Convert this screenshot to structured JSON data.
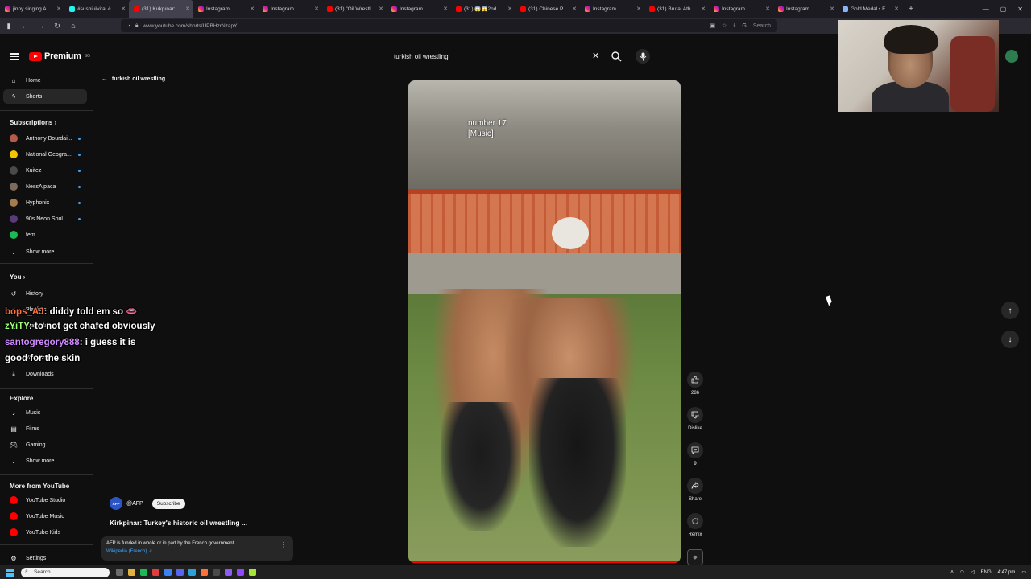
{
  "browser": {
    "tabs": [
      {
        "label": "jinny singing AWAY",
        "favicon": "ig"
      },
      {
        "label": "#sushi #viral #chall",
        "favicon": "tt"
      },
      {
        "label": "(31) Kırkpınar:",
        "favicon": "yt",
        "active": true
      },
      {
        "label": "Instagram",
        "favicon": "ig"
      },
      {
        "label": "Instagram",
        "favicon": "ig"
      },
      {
        "label": "(31) \"Oil Wrestling\"",
        "favicon": "yt"
      },
      {
        "label": "Instagram",
        "favicon": "ig"
      },
      {
        "label": "(31) 😱😱2nd con",
        "favicon": "yt"
      },
      {
        "label": "(31) Chinese Presid",
        "favicon": "yt"
      },
      {
        "label": "Instagram",
        "favicon": "ig"
      },
      {
        "label": "(31) Brutal Atheist",
        "favicon": "yt"
      },
      {
        "label": "Instagram",
        "favicon": "ig"
      },
      {
        "label": "Instagram",
        "favicon": "ig"
      },
      {
        "label": "Gold Medal • FS 6",
        "favicon": "gen"
      }
    ],
    "url": "www.youtube.com/shorts/UPBHzrNzapY",
    "search_placeholder": "Search"
  },
  "header": {
    "logo_text": "Premium",
    "logo_sup": "SG",
    "search_value": "turkish oil wrestling"
  },
  "sidebar": {
    "primary": [
      {
        "label": "Home",
        "icon": "home-icon"
      },
      {
        "label": "Shorts",
        "icon": "shorts-icon",
        "active": true
      }
    ],
    "subscriptions_title": "Subscriptions",
    "subscriptions": [
      {
        "label": "Anthony Bourdai...",
        "color": "#b35a4a"
      },
      {
        "label": "National Geogra...",
        "color": "#f5c400"
      },
      {
        "label": "Kuitez",
        "color": "#4a4a4a"
      },
      {
        "label": "NessAlpaca",
        "color": "#7c6a5a"
      },
      {
        "label": "Hyphonix",
        "color": "#a47b4c"
      },
      {
        "label": "90s Neon Soul",
        "color": "#5b3a7a"
      },
      {
        "label": "fem",
        "color": "#1db954"
      }
    ],
    "show_more": "Show more",
    "you_title": "You",
    "you_items": [
      {
        "label": "History",
        "icon": "history-icon"
      },
      {
        "label": "Playlists",
        "icon": "playlist-icon"
      },
      {
        "label": "Watch later",
        "icon": "clock-icon"
      },
      {
        "label": "Liked videos",
        "icon": "like-icon"
      },
      {
        "label": "Your videos",
        "icon": "video-icon"
      },
      {
        "label": "Downloads",
        "icon": "download-icon"
      }
    ],
    "explore_title": "Explore",
    "explore_items": [
      {
        "label": "Music",
        "icon": "music-icon"
      },
      {
        "label": "Films",
        "icon": "film-icon"
      },
      {
        "label": "Gaming",
        "icon": "gaming-icon"
      }
    ],
    "show_more_2": "Show more",
    "more_title": "More from YouTube",
    "more_items": [
      {
        "label": "YouTube Studio"
      },
      {
        "label": "YouTube Music"
      },
      {
        "label": "YouTube Kids"
      }
    ],
    "settings": "Settings"
  },
  "back_title": "turkish oil wrestling",
  "video": {
    "caption": "number 17\n[Music]",
    "progress": 0.99
  },
  "actions": {
    "like_count": "286",
    "dislike_label": "Dislike",
    "comments_count": "9",
    "share_label": "Share",
    "remix_label": "Remix"
  },
  "info": {
    "channel_avatar": "AFP",
    "channel_handle": "@AFP",
    "subscribe_label": "Subscribe",
    "title": "Kirkpinar: Turkey's historic oil wrestling ...",
    "panel_text": "AFP is funded in whole or in part by the French government.",
    "panel_link": "Wikipedia (French) ↗"
  },
  "chat": [
    {
      "user": "bops_AJ",
      "message": ": diddy told em so 👄"
    },
    {
      "user": "zYiTY",
      "message": ": to not get chafed obviously"
    },
    {
      "user": "santogregory888",
      "message": ": i guess it is"
    },
    {
      "user": "",
      "message": "good for the skin"
    }
  ],
  "taskbar": {
    "search_label": "Search",
    "lang": "ENG",
    "time": "4:47 pm"
  }
}
